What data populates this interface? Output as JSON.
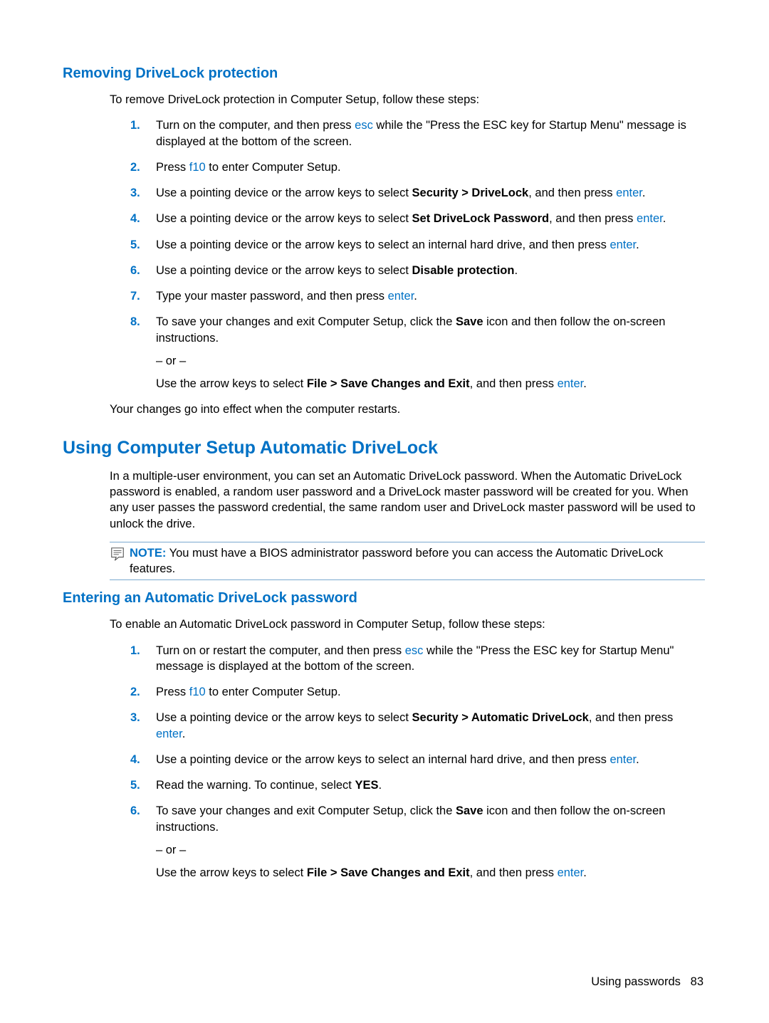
{
  "section1": {
    "title": "Removing DriveLock protection",
    "intro": "To remove DriveLock protection in Computer Setup, follow these steps:",
    "steps": [
      {
        "num": "1.",
        "pre": "Turn on the computer, and then press ",
        "key": "esc",
        "post": " while the \"Press the ESC key for Startup Menu\" message is displayed at the bottom of the screen."
      },
      {
        "num": "2.",
        "pre": "Press ",
        "key": "f10",
        "post": " to enter Computer Setup."
      },
      {
        "num": "3.",
        "pre": "Use a pointing device or the arrow keys to select ",
        "bold": "Security > DriveLock",
        "mid": ", and then press ",
        "key": "enter",
        "post": "."
      },
      {
        "num": "4.",
        "pre": "Use a pointing device or the arrow keys to select ",
        "bold": "Set DriveLock Password",
        "mid": ", and then press ",
        "key": "enter",
        "post": "."
      },
      {
        "num": "5.",
        "pre": "Use a pointing device or the arrow keys to select an internal hard drive, and then press ",
        "key": "enter",
        "post": "."
      },
      {
        "num": "6.",
        "pre": "Use a pointing device or the arrow keys to select ",
        "bold": "Disable protection",
        "post": "."
      },
      {
        "num": "7.",
        "pre": "Type your master password, and then press ",
        "key": "enter",
        "post": "."
      },
      {
        "num": "8.",
        "main_pre": "To save your changes and exit Computer Setup, click the ",
        "main_bold": "Save",
        "main_post": " icon and then follow the on-screen instructions.",
        "or": "– or –",
        "alt_pre": "Use the arrow keys to select ",
        "alt_bold": "File > Save Changes and Exit",
        "alt_mid": ", and then press ",
        "alt_key": "enter",
        "alt_post": "."
      }
    ],
    "outro": "Your changes go into effect when the computer restarts."
  },
  "section2": {
    "title": "Using Computer Setup Automatic DriveLock",
    "para": "In a multiple-user environment, you can set an Automatic DriveLock password. When the Automatic DriveLock password is enabled, a random user password and a DriveLock master password will be created for you. When any user passes the password credential, the same random user and DriveLock master password will be used to unlock the drive.",
    "note_label": "NOTE:",
    "note_text": "   You must have a BIOS administrator password before you can access the Automatic DriveLock features."
  },
  "section3": {
    "title": "Entering an Automatic DriveLock password",
    "intro": "To enable an Automatic DriveLock password in Computer Setup, follow these steps:",
    "steps": [
      {
        "num": "1.",
        "pre": "Turn on or restart the computer, and then press ",
        "key": "esc",
        "post": " while the \"Press the ESC key for Startup Menu\" message is displayed at the bottom of the screen."
      },
      {
        "num": "2.",
        "pre": "Press ",
        "key": "f10",
        "post": " to enter Computer Setup."
      },
      {
        "num": "3.",
        "pre": "Use a pointing device or the arrow keys to select ",
        "bold": "Security > Automatic DriveLock",
        "mid": ", and then press ",
        "key": "enter",
        "post": "."
      },
      {
        "num": "4.",
        "pre": "Use a pointing device or the arrow keys to select an internal hard drive, and then press ",
        "key": "enter",
        "post": "."
      },
      {
        "num": "5.",
        "pre": "Read the warning. To continue, select ",
        "bold": "YES",
        "post": "."
      },
      {
        "num": "6.",
        "main_pre": "To save your changes and exit Computer Setup, click the ",
        "main_bold": "Save",
        "main_post": " icon and then follow the on-screen instructions.",
        "or": "– or –",
        "alt_pre": "Use the arrow keys to select ",
        "alt_bold": "File > Save Changes and Exit",
        "alt_mid": ", and then press ",
        "alt_key": "enter",
        "alt_post": "."
      }
    ]
  },
  "footer": {
    "text": "Using passwords",
    "pagenum": "83"
  }
}
